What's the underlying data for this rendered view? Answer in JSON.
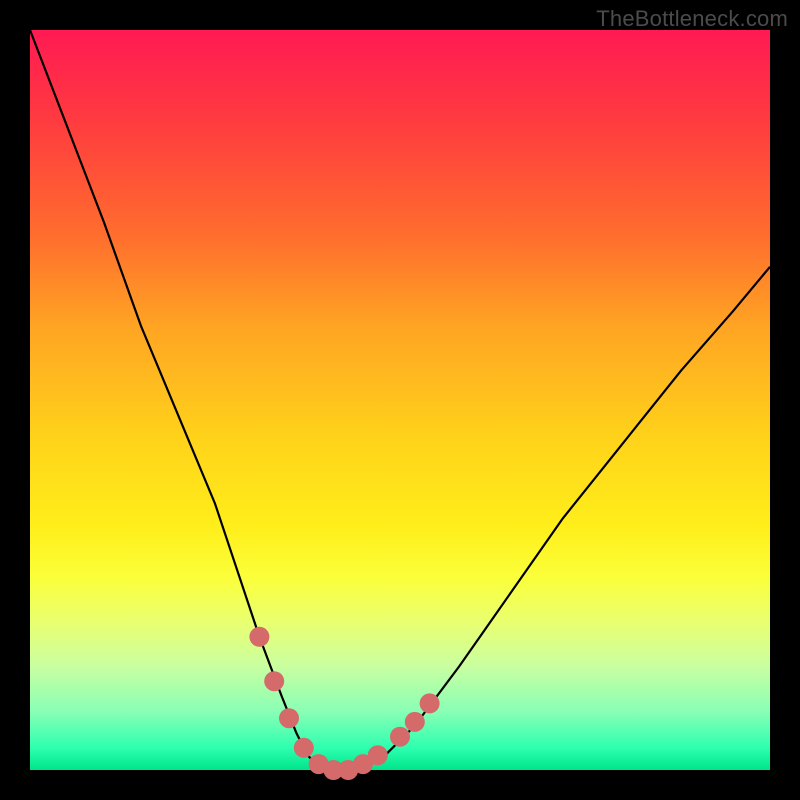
{
  "watermark": "TheBottleneck.com",
  "chart_data": {
    "type": "line",
    "title": "",
    "xlabel": "",
    "ylabel": "",
    "xlim": [
      0,
      100
    ],
    "ylim": [
      0,
      100
    ],
    "series": [
      {
        "name": "bottleneck-curve",
        "x": [
          0,
          5,
          10,
          15,
          20,
          25,
          28,
          31,
          34,
          36,
          37.5,
          39,
          41,
          43,
          45,
          48,
          52,
          58,
          65,
          72,
          80,
          88,
          95,
          100
        ],
        "values": [
          100,
          87,
          74,
          60,
          48,
          36,
          27,
          18,
          10,
          5,
          2,
          0.5,
          0,
          0,
          0.5,
          2,
          6,
          14,
          24,
          34,
          44,
          54,
          62,
          68
        ]
      }
    ],
    "highlight_points": {
      "name": "curve-markers",
      "color": "#d46a6a",
      "points": [
        {
          "x": 31,
          "y": 18
        },
        {
          "x": 33,
          "y": 12
        },
        {
          "x": 35,
          "y": 7
        },
        {
          "x": 37,
          "y": 3
        },
        {
          "x": 39,
          "y": 0.8
        },
        {
          "x": 41,
          "y": 0
        },
        {
          "x": 43,
          "y": 0
        },
        {
          "x": 45,
          "y": 0.8
        },
        {
          "x": 47,
          "y": 2
        },
        {
          "x": 50,
          "y": 4.5
        },
        {
          "x": 52,
          "y": 6.5
        },
        {
          "x": 54,
          "y": 9
        }
      ]
    }
  }
}
